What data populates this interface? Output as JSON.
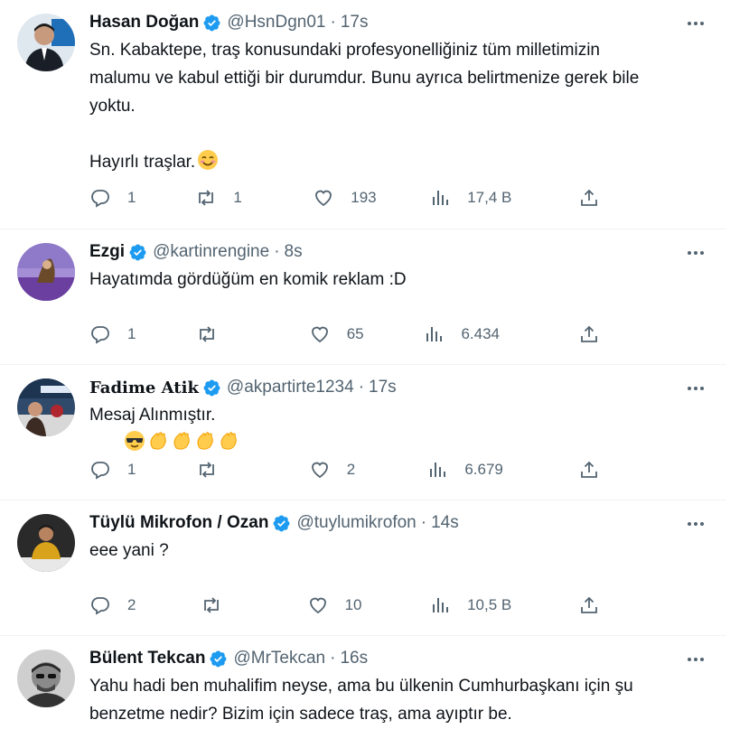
{
  "tweets": [
    {
      "name": "Hasan Doğan",
      "handle": "@HsnDgn01",
      "time": "17s",
      "text": "Sn. Kabaktepe, traş konusundaki profesyonelliğiniz tüm milletimizin\nmalumu ve kabul ettiği bir durumdur. Bunu ayrıca belirtmenize gerek bile\nyoktu.\n\nHayırlı traşlar.",
      "emoji": "smiling-face-emoji",
      "replies": "1",
      "retweets": "1",
      "likes": "193",
      "views": "17,4 B",
      "avatar_color": "#2b3a4a"
    },
    {
      "name": "Ezgi",
      "handle": "@kartinrengine",
      "time": "8s",
      "text": "Hayatımda gördüğüm en komik reklam :D",
      "replies": "1",
      "retweets": "",
      "likes": "65",
      "views": "6.434",
      "avatar_color": "#7a56b0"
    },
    {
      "name": "Fadime Atik",
      "handle": "@akpartirte1234",
      "time": "17s",
      "text": "Mesaj Alınmıştır.",
      "emoji": "sunglasses-and-clapping-hands-emoji",
      "replies": "1",
      "retweets": "",
      "likes": "2",
      "views": "6.679",
      "avatar_color": "#3a4f66"
    },
    {
      "name": "Tüylü Mikrofon / Ozan",
      "handle": "@tuylumikrofon",
      "time": "14s",
      "text": "eee yani ?",
      "replies": "2",
      "retweets": "",
      "likes": "10",
      "views": "10,5 B",
      "avatar_color": "#c9a227"
    },
    {
      "name": "Bülent Tekcan",
      "handle": "@MrTekcan",
      "time": "16s",
      "text": "Yahu hadi ben muhalifim neyse, ama bu ülkenin Cumhurbaşkanı için şu\nbenzetme nedir? Bizim için sadece traş, ama ayıptır be.",
      "avatar_color": "#555555"
    }
  ],
  "colors": {
    "verified": "#1d9bf0",
    "secondary": "#536471",
    "text": "#0f1419",
    "divider": "#eff3f4"
  }
}
